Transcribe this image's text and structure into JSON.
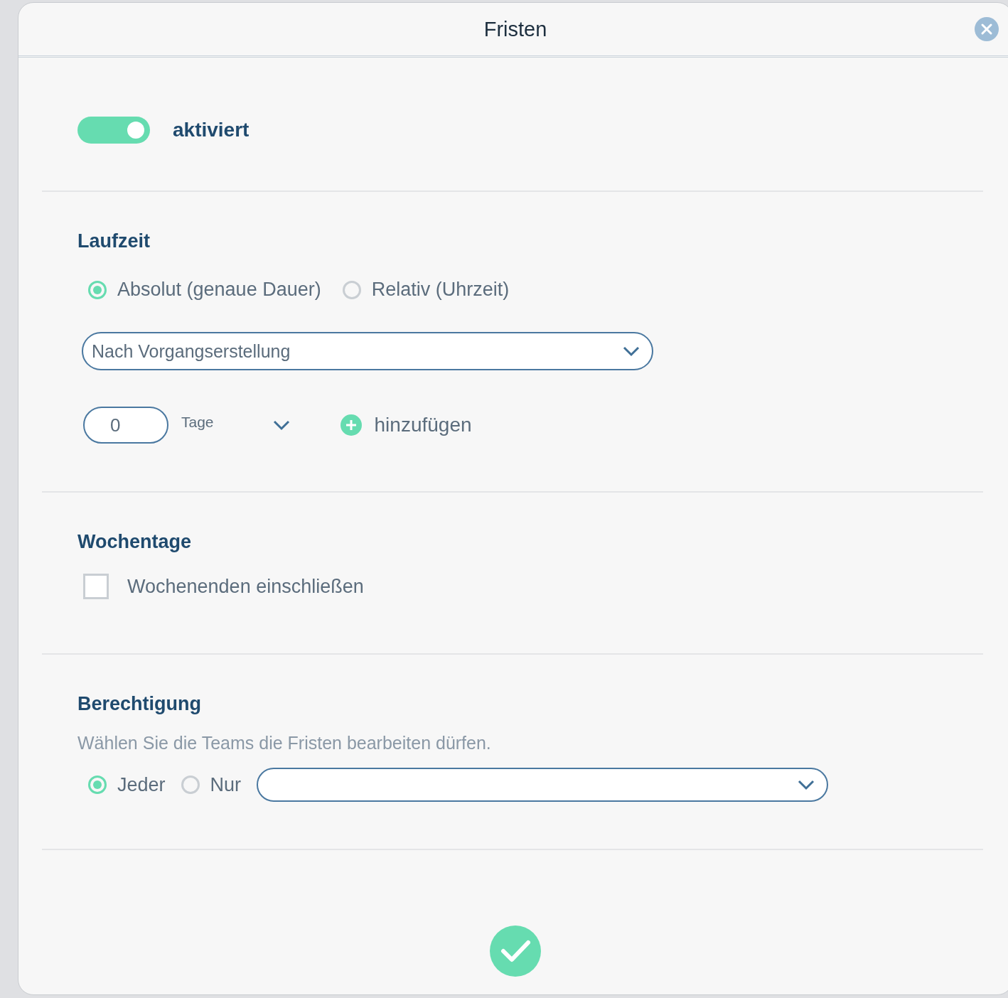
{
  "dialog": {
    "title": "Fristen"
  },
  "toggle": {
    "label": "aktiviert",
    "on": true
  },
  "laufzeit": {
    "heading": "Laufzeit",
    "modes": [
      {
        "label": "Absolut (genaue Dauer)",
        "selected": true
      },
      {
        "label": "Relativ (Uhrzeit)",
        "selected": false
      }
    ],
    "trigger_select": {
      "value": "Nach Vorgangserstellung"
    },
    "duration": {
      "value": "0",
      "unit": "Tage"
    },
    "add_button": {
      "label": "hinzufügen"
    }
  },
  "wochentage": {
    "heading": "Wochentage",
    "weekends": {
      "label": "Wochenenden einschließen",
      "checked": false
    }
  },
  "berechtigung": {
    "heading": "Berechtigung",
    "description": "Wählen Sie die Teams die Fristen bearbeiten dürfen.",
    "options": [
      {
        "label": "Jeder",
        "selected": true
      },
      {
        "label": "Nur",
        "selected": false
      }
    ]
  }
}
